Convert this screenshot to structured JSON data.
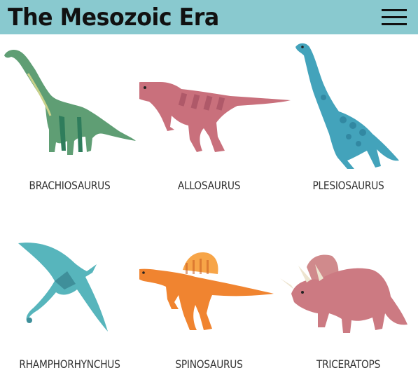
{
  "header": {
    "title": "The Mesozoic Era",
    "menu_icon": "hamburger-menu-icon"
  },
  "dinosaurs": [
    {
      "name": "BRACHIOSAURUS",
      "color": "#5a9a6e"
    },
    {
      "name": "ALLOSAURUS",
      "color": "#c46b78"
    },
    {
      "name": "PLESIOSAURUS",
      "color": "#3f9fb8"
    },
    {
      "name": "RHAMPHORHYNCHUS",
      "color": "#4fb0b5"
    },
    {
      "name": "SPINOSAURUS",
      "color": "#f08a30"
    },
    {
      "name": "TRICERATOPS",
      "color": "#c9747a"
    }
  ]
}
